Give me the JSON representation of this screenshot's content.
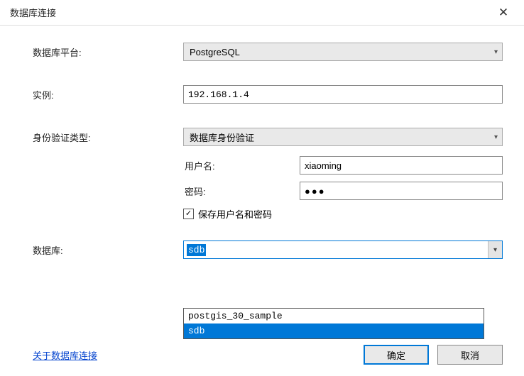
{
  "window": {
    "title": "数据库连接"
  },
  "labels": {
    "platform": "数据库平台:",
    "instance": "实例:",
    "authtype": "身份验证类型:",
    "username": "用户名:",
    "password": "密码:",
    "savecreds": "保存用户名和密码",
    "database": "数据库:"
  },
  "values": {
    "platform": "PostgreSQL",
    "instance": "192.168.1.4",
    "authtype": "数据库身份验证",
    "username": "xiaoming",
    "password_mask": "●●●",
    "database": "sdb",
    "checkbox_mark": "✓"
  },
  "dropdown": {
    "items": [
      "postgis_30_sample",
      "sdb"
    ],
    "selected": "sdb"
  },
  "footer": {
    "link": "关于数据库连接",
    "ok": "确定",
    "cancel": "取消"
  }
}
